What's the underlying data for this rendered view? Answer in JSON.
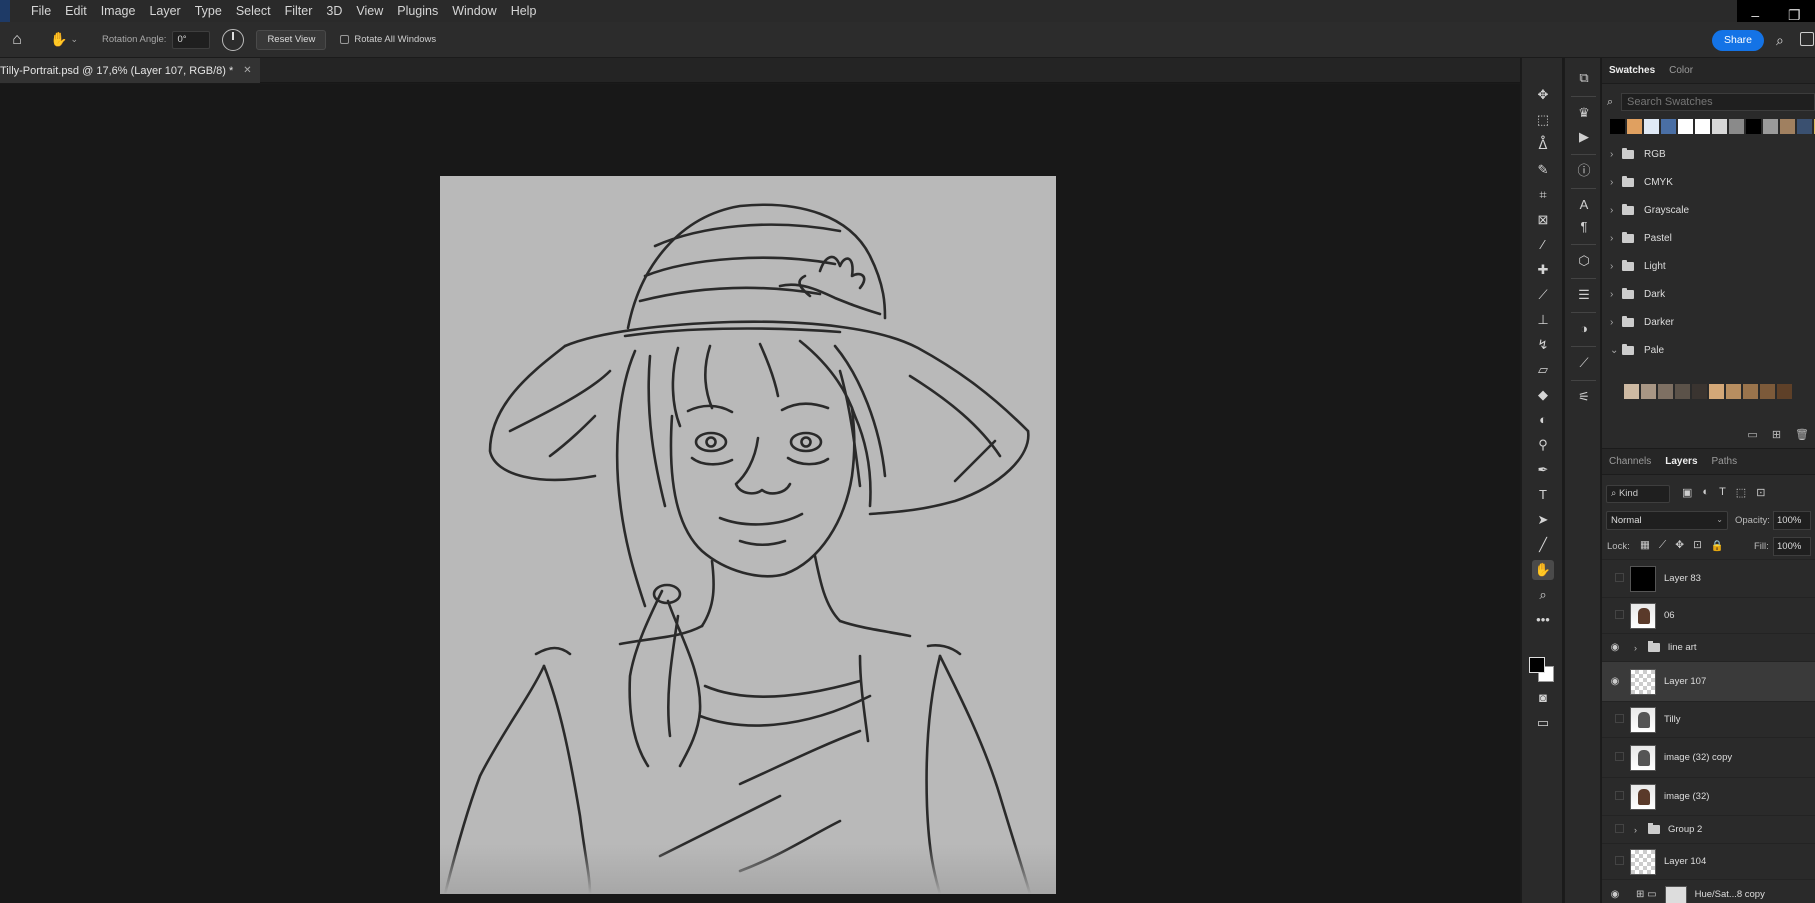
{
  "menu": [
    "File",
    "Edit",
    "Image",
    "Layer",
    "Type",
    "Select",
    "Filter",
    "3D",
    "View",
    "Plugins",
    "Window",
    "Help"
  ],
  "options": {
    "rotation_label": "Rotation Angle:",
    "rotation_value": "0°",
    "reset_view": "Reset View",
    "rotate_all": "Rotate All Windows"
  },
  "share": "Share",
  "document_tab": "Tilly-Portrait.psd @ 17,6% (Layer 107, RGB/8) *",
  "swatches": {
    "tabs": [
      "Swatches",
      "Color"
    ],
    "search_placeholder": "Search Swatches",
    "recent": [
      "#000000",
      "#e0a060",
      "#dfe9f5",
      "#4a6fa5",
      "#ffffff",
      "#ffffff",
      "#d8d8d8",
      "#8a8a8a",
      "#000000",
      "#9a9a9a",
      "#a08060",
      "#3a5070",
      "#d7b860"
    ],
    "folders": [
      "RGB",
      "CMYK",
      "Grayscale",
      "Pastel",
      "Light",
      "Dark",
      "Darker",
      "Pale"
    ],
    "pale": [
      "#cdb9a2",
      "#a89684",
      "#7e7063",
      "#5b5249",
      "#3a3430",
      "#d4a878",
      "#b88e60",
      "#9a744c",
      "#7c5a3a",
      "#5e4028"
    ]
  },
  "layers_panel": {
    "tabs": [
      "Channels",
      "Layers",
      "Paths"
    ],
    "kind": "Kind",
    "blend_mode": "Normal",
    "opacity_label": "Opacity:",
    "opacity": "100%",
    "lock_label": "Lock:",
    "fill_label": "Fill:",
    "fill": "100%",
    "layers": [
      {
        "name": "Layer 83",
        "visible": false,
        "thumb": "black"
      },
      {
        "name": "06",
        "visible": false,
        "thumb": "photo"
      },
      {
        "name": "line art",
        "visible": true,
        "thumb": "group"
      },
      {
        "name": "Layer 107",
        "visible": true,
        "thumb": "checker",
        "selected": true
      },
      {
        "name": "Tilly",
        "visible": false,
        "thumb": "photo-gray"
      },
      {
        "name": "image (32) copy",
        "visible": false,
        "thumb": "photo-gray"
      },
      {
        "name": "image (32)",
        "visible": false,
        "thumb": "photo"
      },
      {
        "name": "Group 2",
        "visible": false,
        "thumb": "group"
      },
      {
        "name": "Layer 104",
        "visible": false,
        "thumb": "checker"
      },
      {
        "name": "Hue/Sat...8 copy",
        "visible": true,
        "thumb": "adjust"
      }
    ]
  },
  "tools": [
    "move-tool",
    "marquee-tool",
    "lasso-tool",
    "quick-select-tool",
    "crop-tool",
    "frame-tool",
    "eyedropper-tool",
    "healing-tool",
    "brush-tool",
    "stamp-tool",
    "history-brush-tool",
    "eraser-tool",
    "bucket-tool",
    "blur-tool",
    "dodge-tool",
    "pen-tool",
    "type-tool",
    "path-select-tool",
    "line-tool",
    "rotate-view-tool",
    "zoom-tool",
    "more-tools"
  ]
}
